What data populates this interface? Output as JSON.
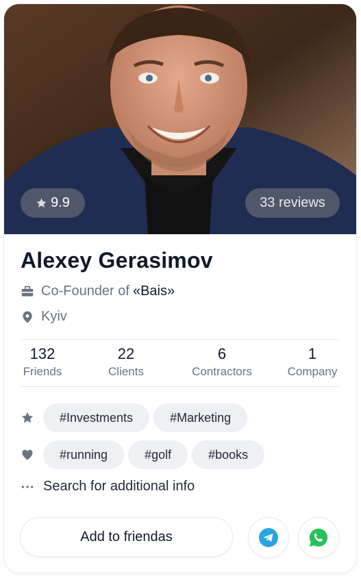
{
  "profile": {
    "name": "Alexey Gerasimov",
    "rating": "9.9",
    "reviews": "33 reviews",
    "role_prefix": "Co-Founder of",
    "company": "«Bais»",
    "city": "Kyiv"
  },
  "stats": [
    {
      "value": "132",
      "label": "Friends"
    },
    {
      "value": "22",
      "label": "Clients"
    },
    {
      "value": "6",
      "label": "Contractors"
    },
    {
      "value": "1",
      "label": "Company"
    }
  ],
  "interests": {
    "professional": [
      "#Investments",
      "#Marketing"
    ],
    "hobbies": [
      "#running",
      "#golf",
      "#books"
    ]
  },
  "more_info": "Search for additional info",
  "actions": {
    "add_friend": "Add to friendas"
  },
  "colors": {
    "telegram": "#2AA3E0",
    "whatsapp": "#25C25A",
    "icon_gray": "#6b7280",
    "tag_bg": "#eef0f4"
  },
  "icons": {
    "rating": "star-icon",
    "role": "briefcase-icon",
    "location": "map-pin-icon",
    "professional": "star-icon",
    "hobbies": "heart-icon",
    "more": "dots-icon",
    "messenger_1": "telegram-icon",
    "messenger_2": "whatsapp-icon"
  }
}
